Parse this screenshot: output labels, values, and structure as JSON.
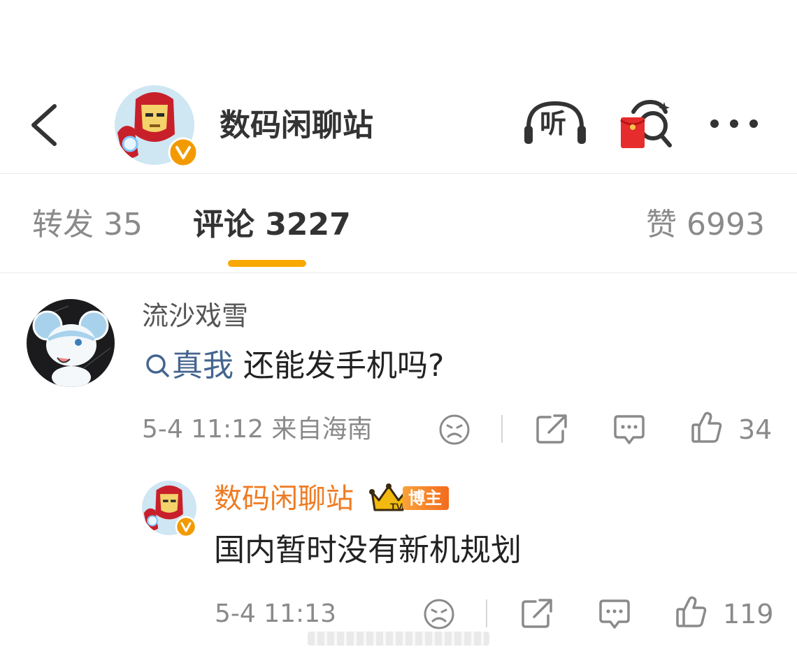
{
  "header": {
    "title": "数码闲聊站",
    "listen_label": "听"
  },
  "tabs": [
    {
      "label": "转发 35"
    },
    {
      "label": "评论 3227"
    },
    {
      "label": "赞 6993"
    }
  ],
  "comments": [
    {
      "user": "流沙戏雪",
      "topic": "真我",
      "text": "还能发手机吗?",
      "time": "5-4 11:12",
      "location": "来自海南",
      "likes": "34"
    }
  ],
  "reply": {
    "user": "数码闲聊站",
    "badge": "博主",
    "crown_letters": "TV",
    "text": "国内暂时没有新机规划",
    "time": "5-4 11:13",
    "likes": "119"
  },
  "colors": {
    "accent_underline": "#f8a800",
    "topic_link": "#44658f",
    "blogger_name": "#ef7b22",
    "verified_badge": "#f39a00"
  }
}
